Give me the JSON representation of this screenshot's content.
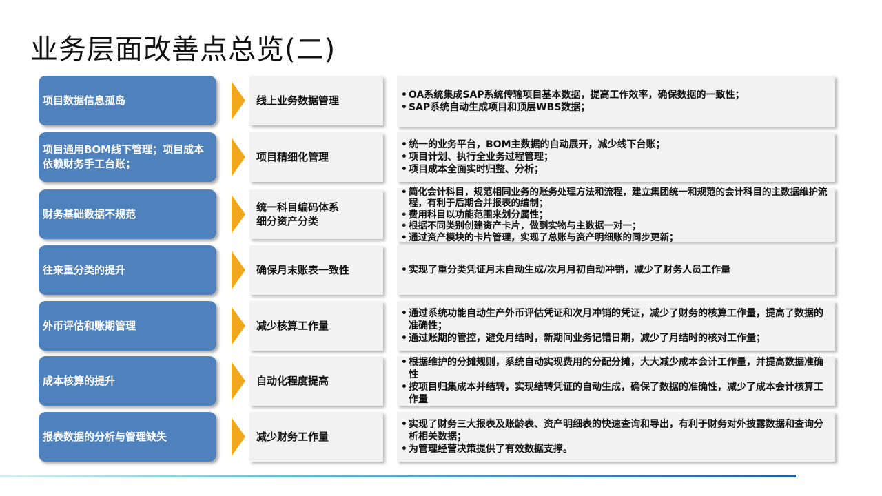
{
  "title": "业务层面改善点总览(二)",
  "colors": {
    "issue_box": "#4f81bd",
    "arrow": "#f0a71b",
    "panel": "#f2f2f2"
  },
  "rows": [
    {
      "issue": "项目数据信息孤岛",
      "target": "线上业务数据管理",
      "details": [
        "OA系统集成SAP系统传输项目基本数据，提高工作效率，确保数据的一致性；",
        "SAP系统自动生成项目和顶层WBS数据；"
      ]
    },
    {
      "issue": "项目通用BOM线下管理；项目成本依赖财务手工台账；",
      "target": "项目精细化管理",
      "details": [
        "统一的业务平台，BOM主数据的自动展开，减少线下台账；",
        "项目计划、执行全业务过程管理；",
        "项目成本全面实时归整、分析；"
      ]
    },
    {
      "issue": "财务基础数据不规范",
      "target": "统一科目编码体系\n细分资产分类",
      "details": [
        "简化会计科目，规范相同业务的账务处理方法和流程，建立集团统一和规范的会计科目的主数据维护流程，有利于后期合并报表的编制；",
        "费用科目以功能范围来划分属性；",
        "根据不同类别创建资产卡片，做到实物与主数据一对一；",
        "通过资产模块的卡片管理，实现了总账与资产明细账的同步更新；"
      ]
    },
    {
      "issue": "往来重分类的提升",
      "target": "确保月末账表一致性",
      "details": [
        "实现了重分类凭证月末自动生成/次月月初自动冲销，减少了财务人员工作量"
      ]
    },
    {
      "issue": "外币评估和账期管理",
      "target": "减少核算工作量",
      "details": [
        "通过系统功能自动生产外币评估凭证和次月冲销的凭证，减少了财务的核算工作量，提高了数据的准确性；",
        "通过账期的管控，避免月结时，新期间业务记错日期，减少了月结时的核对工作量；"
      ]
    },
    {
      "issue": "成本核算的提升",
      "target": "自动化程度提高",
      "details": [
        "根据维护的分摊规则，系统自动实现费用的分配分摊，大大减少成本会计工作量，并提高数据准确性",
        "按项目归集成本并结转，实现结转凭证的自动生成，确保了数据的准确性，减少了成本会计核算工作量"
      ]
    },
    {
      "issue": "报表数据的分析与管理缺失",
      "target": "减少财务工作量",
      "details": [
        "实现了财务三大报表及账龄表、资产明细表的快速查询和导出，有利于财务对外披露数据和查询分析相关数据；",
        "为管理经营决策提供了有效数据支撑。"
      ]
    }
  ]
}
